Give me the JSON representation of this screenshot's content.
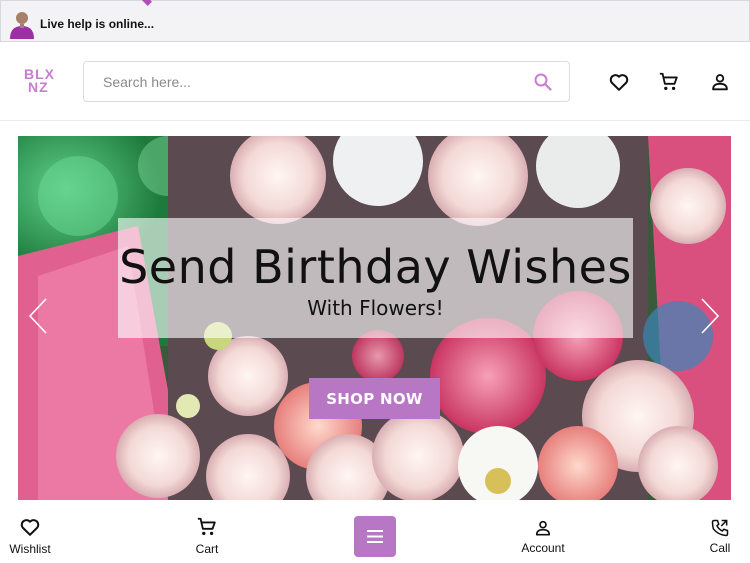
{
  "livehelp": {
    "text": "Live help is online..."
  },
  "header": {
    "logo_line1": "BLX",
    "logo_line2": "NZ",
    "search_placeholder": "Search here..."
  },
  "banner": {
    "title": "Send Birthday Wishes",
    "subtitle": "With Flowers!",
    "cta": "SHOP NOW"
  },
  "bottom_nav": {
    "wishlist": "Wishlist",
    "cart": "Cart",
    "account": "Account",
    "call": "Call"
  },
  "colors": {
    "accent": "#b877c4",
    "logo": "#c77dd0"
  },
  "icons": [
    "user-avatar-icon",
    "heart-icon",
    "cart-icon",
    "account-icon",
    "search-icon",
    "menu-icon",
    "phone-icon",
    "chevron-left-icon",
    "chevron-right-icon"
  ]
}
